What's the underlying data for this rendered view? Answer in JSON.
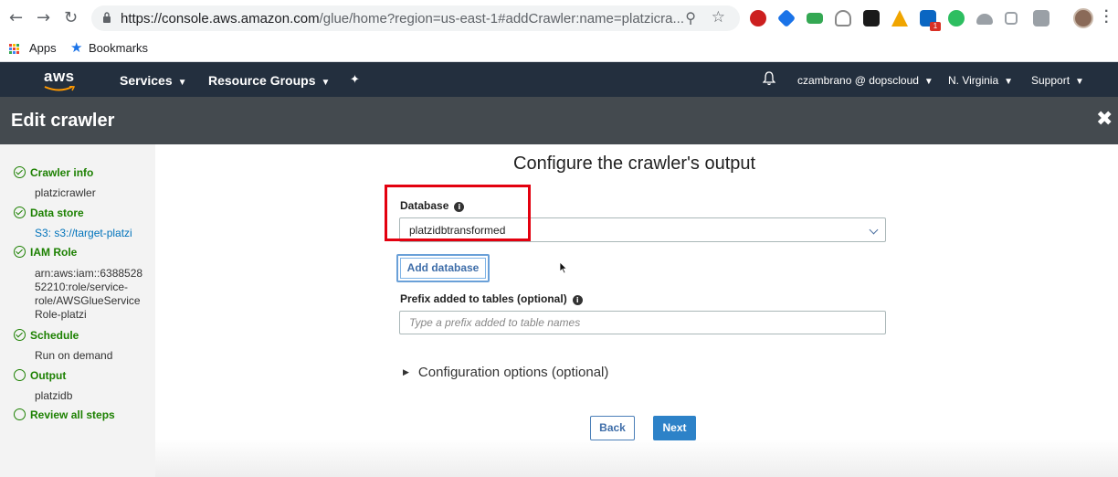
{
  "browser": {
    "url_host": "https://console.aws.amazon.com",
    "url_path": "/glue/home?region=us-east-1#addCrawler:name=platzicra...",
    "bookmarks": [
      {
        "label": "Apps"
      },
      {
        "label": "Bookmarks"
      }
    ],
    "extensions": [
      "opera-icon",
      "nav-icon",
      "inbox-icon",
      "shield-icon",
      "k-icon",
      "drive-warning-icon",
      "linkedin-icon",
      "evernote-icon",
      "cloud-icon",
      "tree-icon",
      "facebook-icon"
    ],
    "linkedin_badge": "1"
  },
  "aws_nav": {
    "logo": "aws",
    "services_label": "Services",
    "resource_groups_label": "Resource Groups",
    "user_label": "czambrano @ dopscloud",
    "region_label": "N. Virginia",
    "support_label": "Support"
  },
  "header": {
    "title": "Edit crawler"
  },
  "sidebar": {
    "steps": [
      {
        "label": "Crawler info",
        "detail": "platzicrawler",
        "done": true
      },
      {
        "label": "Data store",
        "detail": "S3: s3://target-platzi",
        "done": true
      },
      {
        "label": "IAM Role",
        "detail": "arn:aws:iam::638852852210:role/service-role/AWSGlueServiceRole-platzi",
        "detail_lines": [
          "arn:aws:iam::6388528",
          "52210:role/service-",
          "role/AWSGlueService",
          "Role-platzi"
        ],
        "done": true
      },
      {
        "label": "Schedule",
        "detail": "Run on demand",
        "done": true
      },
      {
        "label": "Output",
        "detail": "platzidb",
        "done": false
      },
      {
        "label": "Review all steps",
        "detail": "",
        "done": false
      }
    ]
  },
  "main": {
    "title": "Configure the crawler's output",
    "database_label": "Database",
    "database_value": "platzidbtransformed",
    "add_database_label": "Add database",
    "prefix_label": "Prefix added to tables (optional)",
    "prefix_placeholder": "Type a prefix added to table names",
    "config_options_label": "Configuration options (optional)",
    "back_label": "Back",
    "next_label": "Next"
  },
  "colors": {
    "aws_nav_bg": "#232f3e",
    "header_bg": "#444a4f",
    "step_green": "#1d8102",
    "link_blue": "#0073bb",
    "primary_button": "#2d82c8",
    "highlight_red": "#e3000f"
  }
}
